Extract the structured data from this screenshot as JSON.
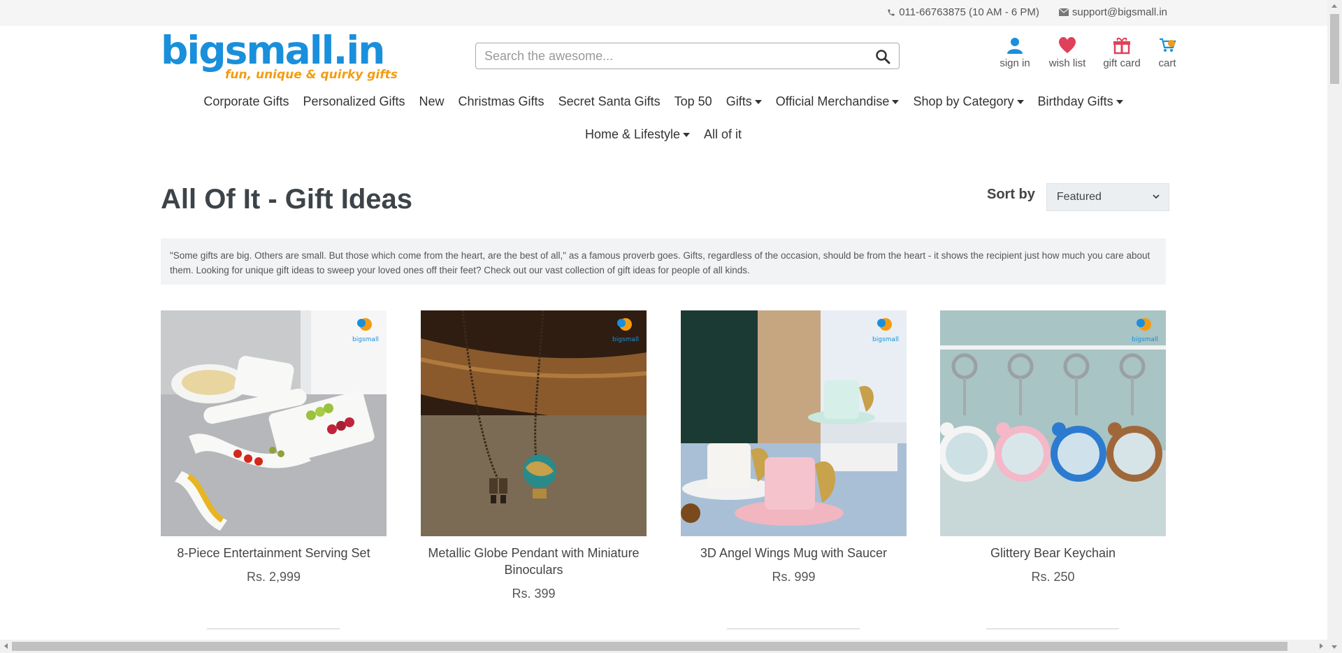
{
  "topbar": {
    "phone": "011-66763875 (10 AM - 6 PM)",
    "email": "support@bigsmall.in"
  },
  "logo": {
    "word": "bigsmall.in",
    "tagline": "fun, unique & quirky gifts"
  },
  "search": {
    "placeholder": "Search the awesome..."
  },
  "user_links": [
    {
      "label": "sign in",
      "icon": "user-icon"
    },
    {
      "label": "wish list",
      "icon": "heart-icon"
    },
    {
      "label": "gift card",
      "icon": "gift-icon"
    },
    {
      "label": "cart",
      "icon": "cart-icon"
    }
  ],
  "nav": {
    "row1": [
      {
        "label": "Corporate Gifts"
      },
      {
        "label": "Personalized Gifts"
      },
      {
        "label": "New"
      },
      {
        "label": "Christmas Gifts"
      },
      {
        "label": "Secret Santa Gifts"
      },
      {
        "label": "Top 50"
      },
      {
        "label": "Gifts"
      },
      {
        "label": "Official Merchandise"
      },
      {
        "label": "Shop by Category"
      },
      {
        "label": "Birthday Gifts"
      }
    ],
    "row2": [
      {
        "label": "Home & Lifestyle"
      },
      {
        "label": "All of it"
      }
    ]
  },
  "page": {
    "title": "All Of It - Gift Ideas",
    "sort_label": "Sort by",
    "sort_value": "Featured",
    "description": "\"Some gifts are big. Others are small. But those which come from the heart, are the best of all,\" as a famous proverb goes. Gifts, regardless of the occasion, should be from the heart - it shows the recipient just how much you care about them. Looking for unique gift ideas to sweep your loved ones off their feet? Check out our vast collection of gift ideas for people of all kinds."
  },
  "products": [
    {
      "title": "8-Piece Entertainment Serving Set",
      "price": "Rs. 2,999"
    },
    {
      "title": "Metallic Globe Pendant with Miniature Binoculars",
      "price": "Rs. 399"
    },
    {
      "title": "3D Angel Wings Mug with Saucer",
      "price": "Rs. 999"
    },
    {
      "title": "Glittery Bear Keychain",
      "price": "Rs. 250"
    }
  ],
  "colors": {
    "brand_blue": "#1a8fdb",
    "brand_orange": "#f39c12",
    "heart": "#e0405a"
  }
}
